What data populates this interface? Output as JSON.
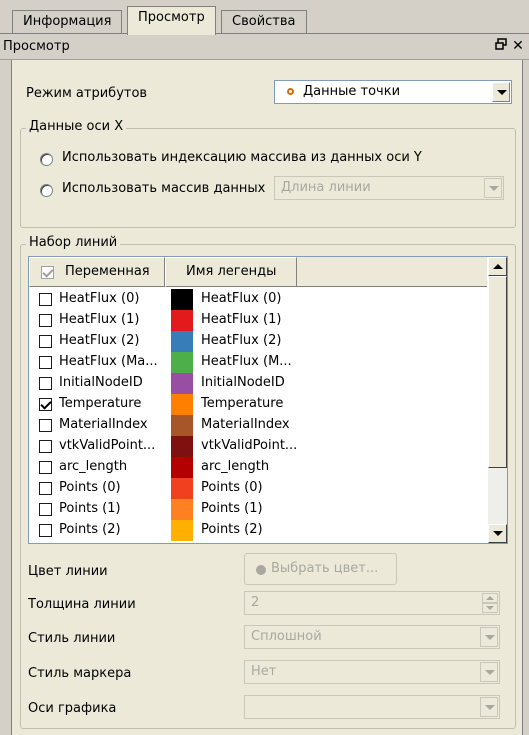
{
  "tabs": [
    {
      "label": "Информация",
      "active": false
    },
    {
      "label": "Просмотр",
      "active": true
    },
    {
      "label": "Свойства",
      "active": false
    }
  ],
  "dock": {
    "title": "Просмотр",
    "float_icon": "float-icon",
    "close_icon": "close-icon"
  },
  "attribute_mode": {
    "label": "Режим атрибутов",
    "value": "Данные точки",
    "value_icon": "point-data-icon"
  },
  "x_axis": {
    "title": "Данные оси X",
    "option_index": "Использовать индексацию массива из данных оси Y",
    "option_array": "Использовать массив данных",
    "array_value": "Длина линии"
  },
  "line_set": {
    "title": "Набор линий",
    "columns": {
      "variable": "Переменная",
      "legend": "Имя легенды"
    },
    "rows": [
      {
        "variable": "HeatFlux (0)",
        "legend": "HeatFlux (0)",
        "color": "#000000",
        "checked": false
      },
      {
        "variable": "HeatFlux (1)",
        "legend": "HeatFlux (1)",
        "color": "#e31a1c",
        "checked": false
      },
      {
        "variable": "HeatFlux (2)",
        "legend": "HeatFlux (2)",
        "color": "#377eb8",
        "checked": false
      },
      {
        "variable": "HeatFlux (Ma...",
        "legend": "HeatFlux (M...",
        "color": "#4daf4a",
        "checked": false
      },
      {
        "variable": "InitialNodeID",
        "legend": "InitialNodeID",
        "color": "#984ea3",
        "checked": false
      },
      {
        "variable": "Temperature",
        "legend": "Temperature",
        "color": "#ff7f00",
        "checked": true
      },
      {
        "variable": "MaterialIndex",
        "legend": "MaterialIndex",
        "color": "#a65628",
        "checked": false
      },
      {
        "variable": "vtkValidPoint...",
        "legend": "vtkValidPoint...",
        "color": "#7f1010",
        "checked": false
      },
      {
        "variable": "arc_length",
        "legend": "arc_length",
        "color": "#b30000",
        "checked": false
      },
      {
        "variable": "Points (0)",
        "legend": "Points (0)",
        "color": "#f04020",
        "checked": false
      },
      {
        "variable": "Points (1)",
        "legend": "Points (1)",
        "color": "#ff8020",
        "checked": false
      },
      {
        "variable": "Points (2)",
        "legend": "Points (2)",
        "color": "#ffb000",
        "checked": false
      }
    ]
  },
  "line_color": {
    "label": "Цвет линии",
    "button": "Выбрать цвет..."
  },
  "line_thickness": {
    "label": "Толщина линии",
    "value": "2"
  },
  "line_style": {
    "label": "Стиль линии",
    "value": "Сплошной"
  },
  "marker_style": {
    "label": "Стиль маркера",
    "value": "Нет"
  },
  "chart_axes": {
    "label": "Оси графика",
    "value": ""
  }
}
